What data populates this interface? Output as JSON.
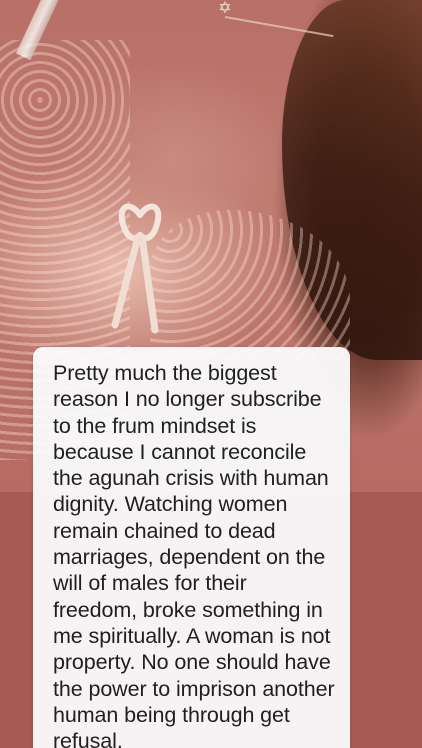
{
  "story": {
    "background_color": "#a75a55",
    "photo": {
      "icons": {
        "pendant": "star-of-david-icon",
        "bow": "ribbon-bow-icon"
      }
    },
    "card": {
      "background_color": "#fafafb",
      "text_color": "#1f1f1f",
      "text": "Pretty much the biggest reason I no longer subscribe to the frum mindset is because I cannot reconcile the agunah crisis with human dignity. Watching women remain chained to dead marriages, dependent on the will of males for their freedom, broke something in me spiritually. A woman is not property. No one should have the power to imprison another human being through get refusal."
    }
  }
}
